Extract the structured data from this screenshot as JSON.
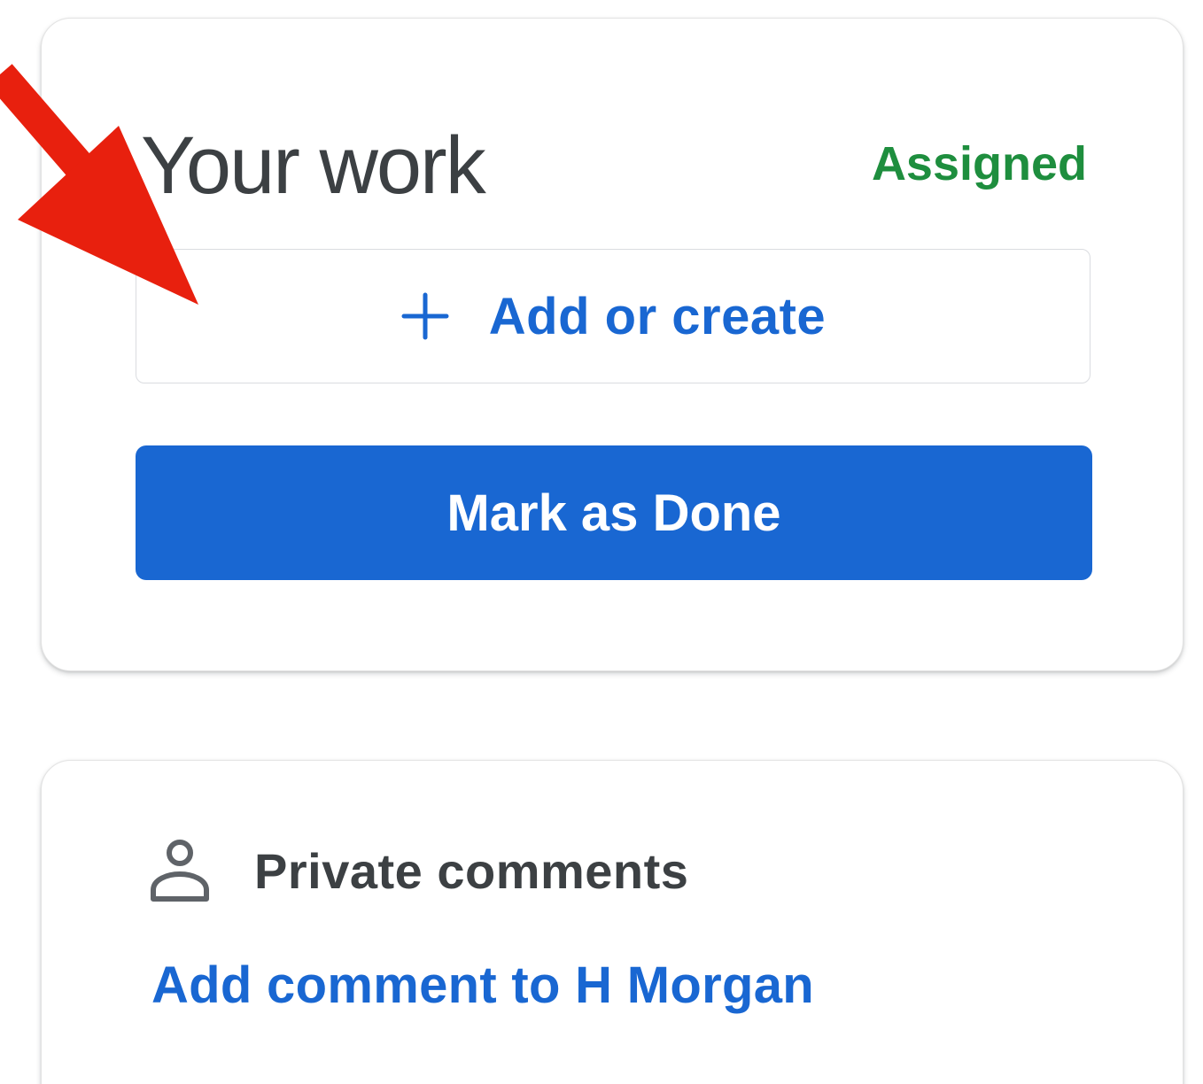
{
  "work_card": {
    "title": "Your work",
    "status": "Assigned",
    "status_color": "#1e8e3e",
    "add_create_label": "Add or create",
    "add_icon": "plus-icon",
    "mark_done_label": "Mark as Done",
    "primary_color": "#1967d2"
  },
  "comments_card": {
    "icon": "person-icon",
    "title": "Private comments",
    "add_comment_label": "Add comment to H Morgan"
  },
  "annotation": {
    "icon": "red-arrow-icon",
    "color": "#e8200e"
  }
}
